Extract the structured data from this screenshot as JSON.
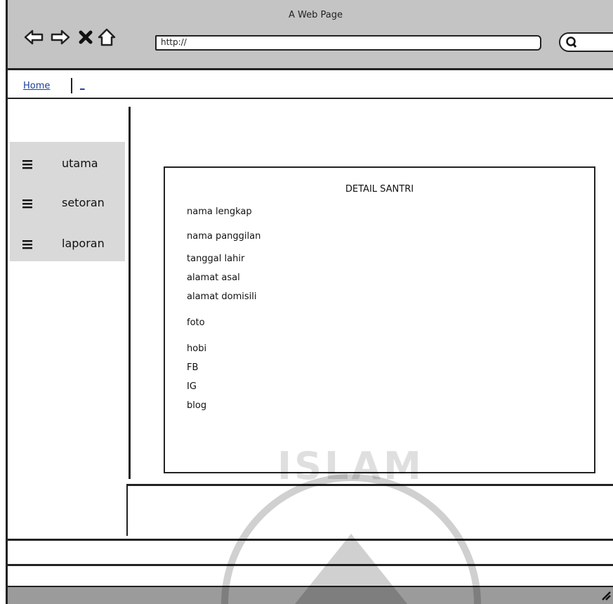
{
  "window": {
    "title": "A Web Page"
  },
  "toolbar": {
    "back_icon": "back-arrow-icon",
    "forward_icon": "forward-arrow-icon",
    "stop_icon": "close-icon",
    "home_icon": "home-icon",
    "url_value": "http://",
    "search_icon": "search-icon"
  },
  "breadcrumb": {
    "home": "Home",
    "second": "_"
  },
  "sidebar": {
    "items": [
      {
        "label": "utama",
        "icon": "menu-icon"
      },
      {
        "label": "setoran",
        "icon": "menu-icon"
      },
      {
        "label": "laporan",
        "icon": "menu-icon"
      }
    ]
  },
  "detail": {
    "title": "DETAIL SANTRI",
    "fields": [
      "nama lengkap",
      "nama panggilan",
      "tanggal lahir",
      "alamat asal",
      "alamat domisili",
      "foto",
      "hobi",
      "FB",
      "IG",
      "blog"
    ]
  },
  "watermark": {
    "text": "ISLAM"
  },
  "colors": {
    "chrome": "#c4c4c4",
    "sidebar": "#d9d9d9",
    "link": "#1a3e9c",
    "footer": "#9b9b9b"
  }
}
